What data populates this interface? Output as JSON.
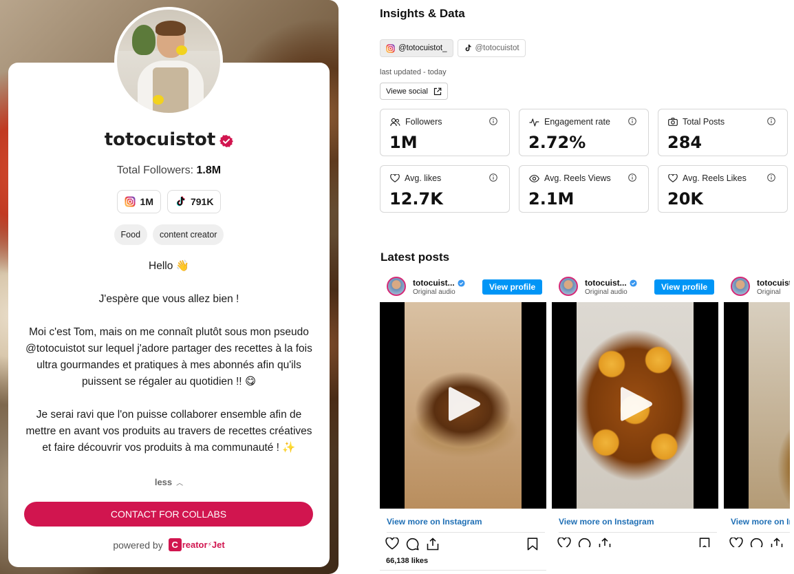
{
  "profile": {
    "username": "totocuistot",
    "total_followers_label": "Total Followers:",
    "total_followers_value": "1.8M",
    "platforms": [
      {
        "name": "instagram",
        "icon": "instagram-icon",
        "count": "1M"
      },
      {
        "name": "tiktok",
        "icon": "tiktok-icon",
        "count": "791K"
      }
    ],
    "tags": [
      "Food",
      "content creator"
    ],
    "bio": {
      "greeting": "Hello 👋",
      "line1": "J'espère que vous allez bien !",
      "para1": "Moi c'est Tom, mais on me connaît plutôt sous mon pseudo @totocuistot sur lequel j'adore partager des recettes à la fois ultra gourmandes et pratiques à mes abonnés afin qu'ils puissent se régaler au quotidien !! 😋",
      "para2": "Je serai ravi que l'on puisse collaborer ensemble afin de mettre en avant vos produits au travers de recettes créatives et faire découvrir vos produits à ma communauté ! ✨"
    },
    "less_label": "less",
    "contact_label": "CONTACT FOR COLLABS",
    "powered_by_label": "powered by",
    "brand": "Creator Jet",
    "brand_mark": "C",
    "brand_text": "reator",
    "brand_sep": "⚡",
    "brand_tail": "Jet",
    "brand_color": "#d1154f"
  },
  "insights": {
    "title": "Insights & Data",
    "accounts": [
      {
        "handle": "@totocuistot_",
        "platform": "instagram",
        "active": true
      },
      {
        "handle": "@totocuistot",
        "platform": "tiktok",
        "active": false
      }
    ],
    "last_updated": "last updated - today",
    "view_social_label": "Viewe social",
    "stats": [
      {
        "label": "Followers",
        "icon": "users-icon",
        "value": "1M"
      },
      {
        "label": "Engagement rate",
        "icon": "activity-icon",
        "value": "2.72%"
      },
      {
        "label": "Total Posts",
        "icon": "camera-icon",
        "value": "284"
      },
      {
        "label": "Avg. likes",
        "icon": "heart-icon",
        "value": "12.7K"
      },
      {
        "label": "Avg. Reels Views",
        "icon": "eye-icon",
        "value": "2.1M"
      },
      {
        "label": "Avg. Reels Likes",
        "icon": "heart-icon",
        "value": "20K"
      }
    ]
  },
  "latest_posts": {
    "title": "Latest posts",
    "posts": [
      {
        "user": "totocuist...",
        "audio": "Original audio",
        "view_profile": "View profile",
        "view_more": "View more on Instagram",
        "likes": "66,138 likes"
      },
      {
        "user": "totocuist...",
        "audio": "Original audio",
        "view_profile": "View profile",
        "view_more": "View more on Instagram",
        "likes": ""
      },
      {
        "user": "totocuist",
        "audio": "Original",
        "view_profile": "",
        "view_more": "View more on In",
        "likes": ""
      }
    ]
  },
  "colors": {
    "accent": "#d1154f",
    "instagram_blue": "#0095f6",
    "link_blue": "#1f6fb5"
  }
}
